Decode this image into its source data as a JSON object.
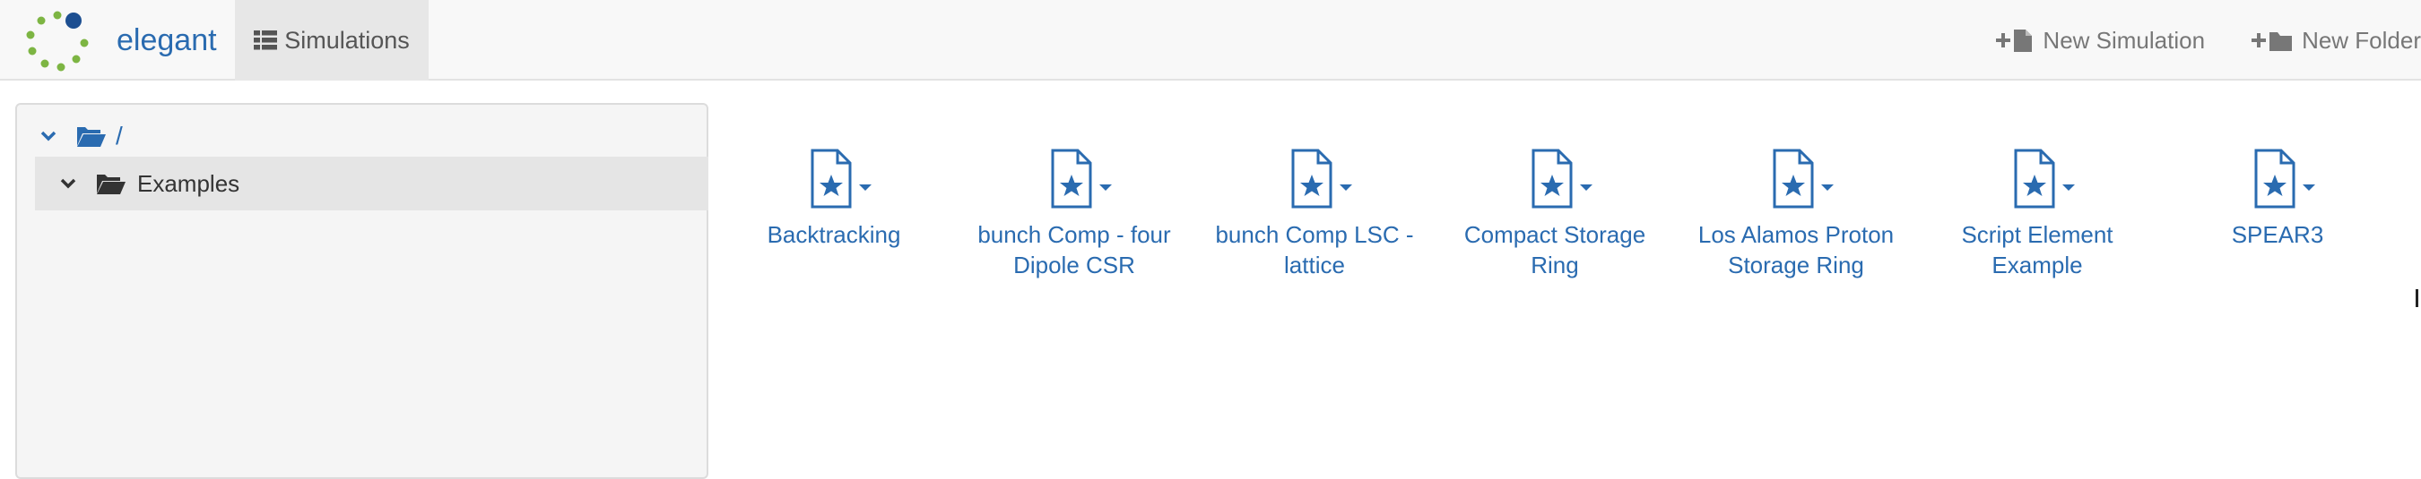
{
  "brand": {
    "name": "elegant"
  },
  "nav": {
    "simulations_tab": "Simulations",
    "new_simulation": "New Simulation",
    "new_folder": "New Folder"
  },
  "tree": {
    "root_label": "/",
    "child_label": "Examples"
  },
  "simulations": [
    {
      "line1": "Backtracking",
      "line2": ""
    },
    {
      "line1": "bunch Comp - four",
      "line2": "Dipole CSR"
    },
    {
      "line1": "bunch Comp LSC -",
      "line2": "lattice"
    },
    {
      "line1": "Compact Storage",
      "line2": "Ring"
    },
    {
      "line1": "Los Alamos Proton",
      "line2": "Storage Ring"
    },
    {
      "line1": "Script Element",
      "line2": "Example"
    },
    {
      "line1": "SPEAR3",
      "line2": ""
    }
  ],
  "colors": {
    "link": "#2a6bb0",
    "navbar_bg": "#f8f8f8",
    "active_tab_bg": "#e7e7e7",
    "logo_green": "#7db543",
    "logo_blue": "#1d4f91"
  },
  "icons": {
    "logo": "elegant-dots-logo",
    "simulations_tab": "list-icon",
    "new_simulation": "plus-file-icon",
    "new_folder": "plus-folder-icon",
    "tree_chevron": "chevron-down-icon",
    "tree_folder": "folder-open-icon",
    "simulation": "file-star-icon",
    "simulation_menu": "caret-down-icon"
  }
}
